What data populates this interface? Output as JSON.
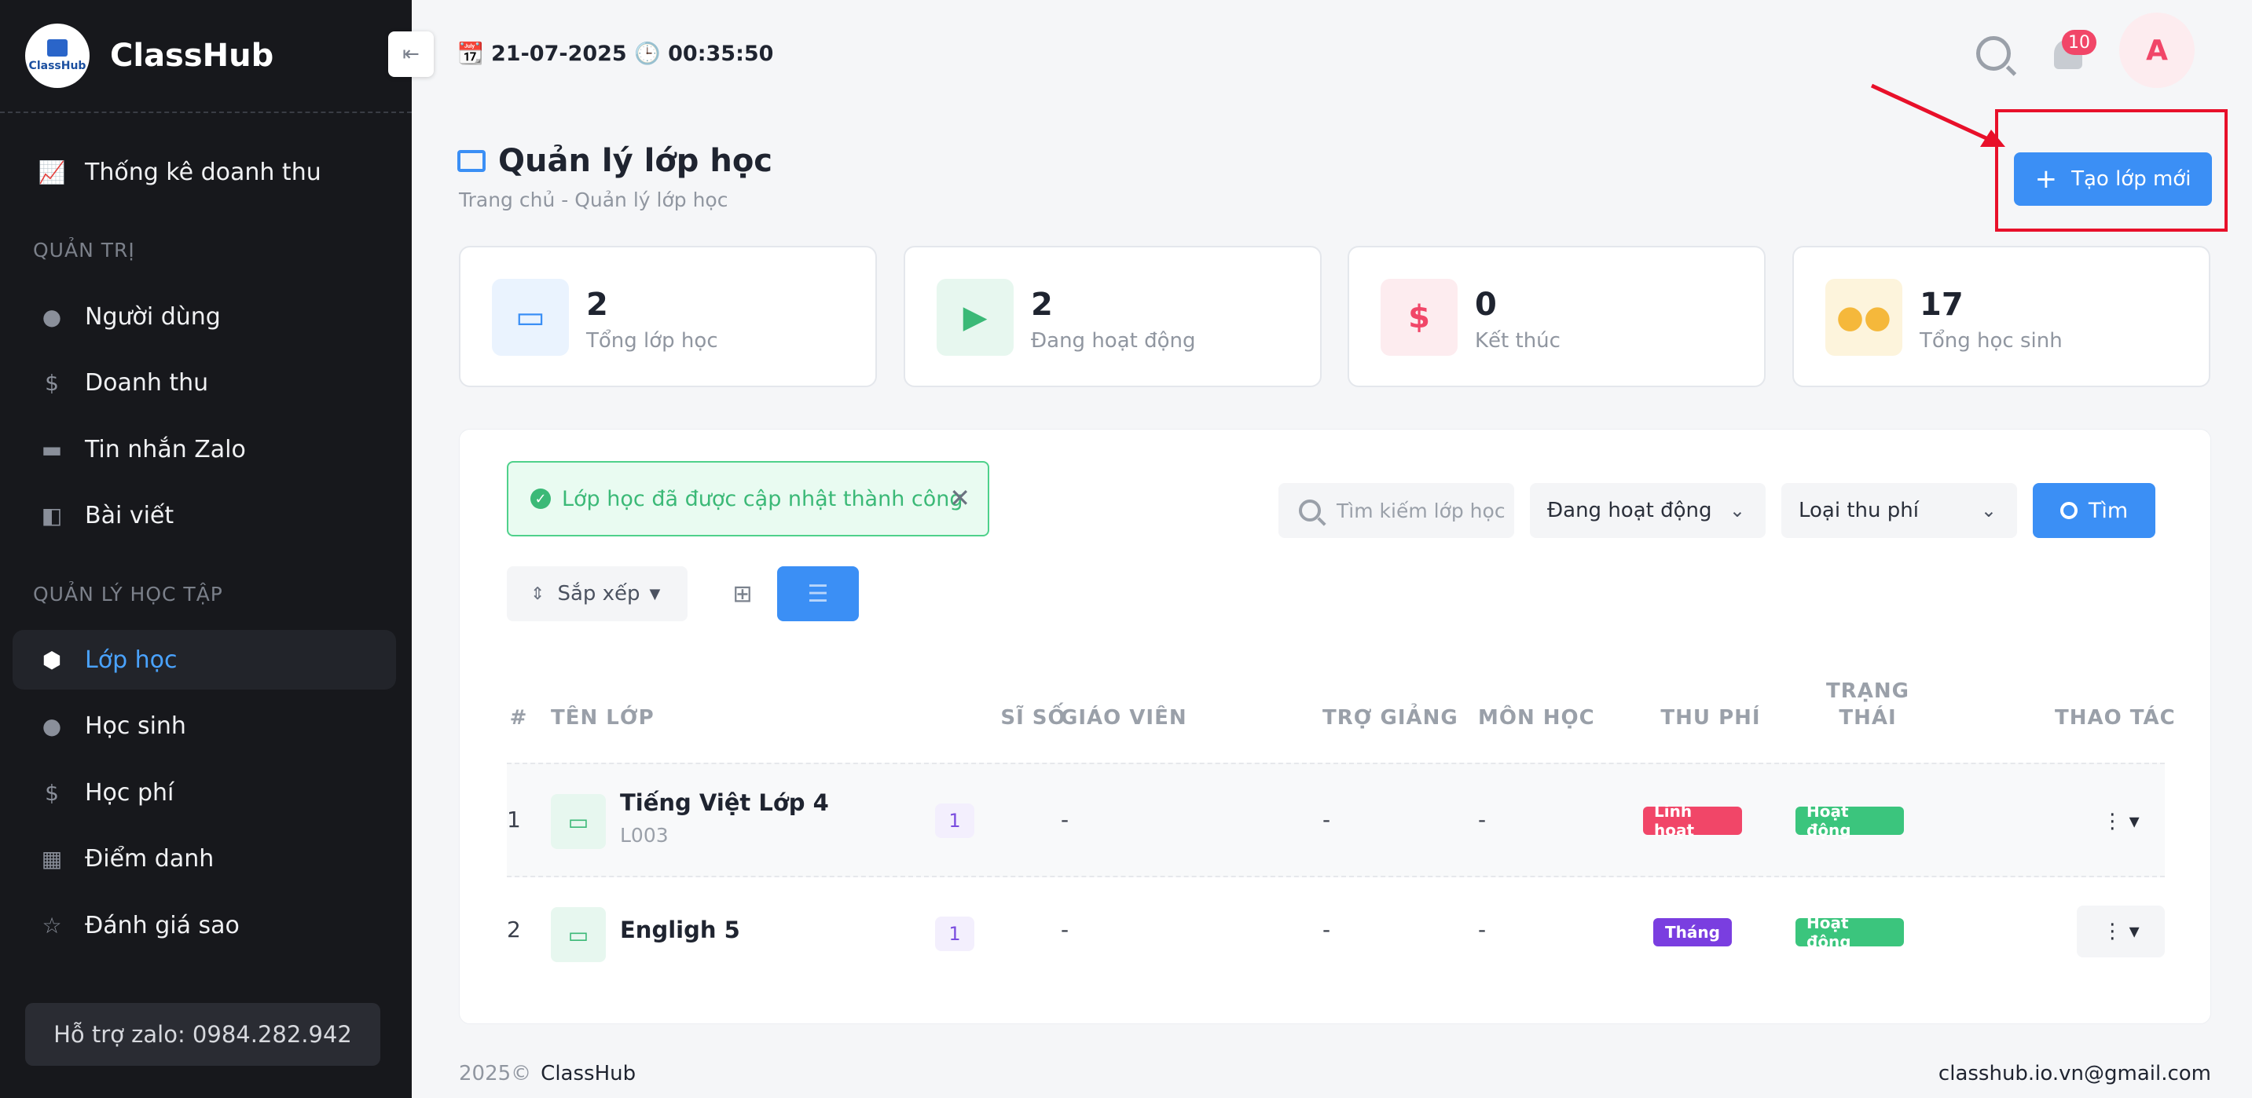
{
  "sidebar": {
    "brand": "ClassHub",
    "logo_text": "ClassHub",
    "revenue_stats": "Thống kê doanh thu",
    "section_admin": "QUẢN TRỊ",
    "items_admin": [
      "Người dùng",
      "Doanh thu",
      "Tin nhắn Zalo",
      "Bài viết"
    ],
    "section_learning": "QUẢN LÝ HỌC TẬP",
    "items_learning": [
      "Lớp học",
      "Học sinh",
      "Học phí",
      "Điểm danh",
      "Đánh giá sao"
    ],
    "support": "Hỗ trợ zalo: 0984.282.942"
  },
  "topbar": {
    "datetime": "📆 21-07-2025 🕒 00:35:50",
    "notifications": "10",
    "avatar": "A"
  },
  "page": {
    "title": "Quản lý lớp học",
    "breadcrumb": "Trang chủ  -  Quản lý lớp học",
    "create_button": "Tạo lớp mới"
  },
  "stats": [
    {
      "value": "2",
      "label": "Tổng lớp học",
      "color": "#3b8ff5"
    },
    {
      "value": "2",
      "label": "Đang hoạt động",
      "color": "#3bb977"
    },
    {
      "value": "0",
      "label": "Kết thúc",
      "color": "#f14668"
    },
    {
      "value": "17",
      "label": "Tổng học sinh",
      "color": "#f5b83b"
    }
  ],
  "toolbar": {
    "alert": "Lớp học đã được cập nhật thành công",
    "search_placeholder": "Tìm kiếm lớp học",
    "status_select": "Đang hoạt động",
    "fee_select": "Loại thu phí",
    "find_button": "Tìm",
    "sort_button": "Sắp xếp"
  },
  "table": {
    "headers": {
      "num": "#",
      "name": "TÊN LỚP",
      "size": "SĨ SỐ",
      "teacher": "GIÁO VIÊN",
      "assistant": "TRỢ GIẢNG",
      "subject": "MÔN HỌC",
      "fee": "THU PHÍ",
      "status_1": "TRẠNG",
      "status_2": "THÁI",
      "actions": "THAO TÁC"
    },
    "rows": [
      {
        "num": "1",
        "name": "Tiếng Việt Lớp 4",
        "code": "L003",
        "size": "1",
        "teacher": "-",
        "assistant": "-",
        "subject": "-",
        "fee": "Linh hoạt",
        "fee_color": "#f14668",
        "status": "Hoạt động",
        "status_color": "#3bc57d"
      },
      {
        "num": "2",
        "name": "Engligh 5",
        "code": "",
        "size": "1",
        "teacher": "-",
        "assistant": "-",
        "subject": "-",
        "fee": "Tháng",
        "fee_color": "#7a3ee0",
        "status": "Hoạt động",
        "status_color": "#3bc57d"
      }
    ]
  },
  "footer": {
    "year": "2025©",
    "brand": "ClassHub",
    "email": "classhub.io.vn@gmail.com"
  }
}
